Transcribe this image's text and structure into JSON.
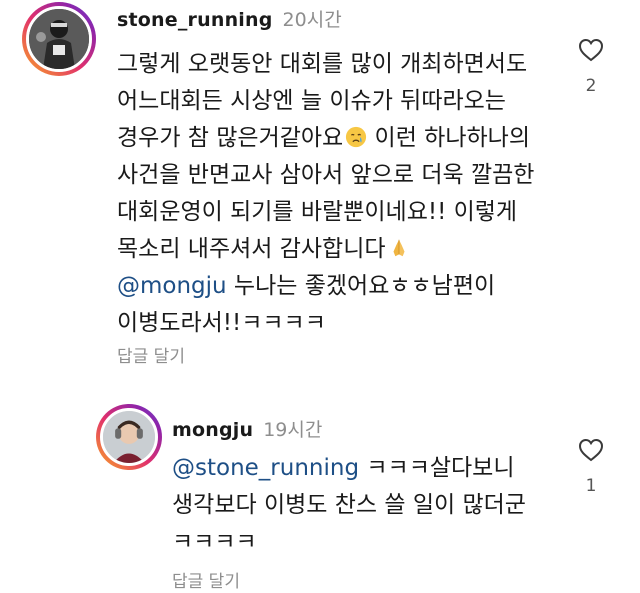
{
  "comments": [
    {
      "username": "stone_running",
      "time": "20시간",
      "lines": [
        "그렇게 오랫동안 대회를 많이 개최하면서도",
        "어느대회든 시상엔 늘 이슈가 뒤따라오는",
        "경우가 참 많은거같아요",
        "사건을 반면교사 삼아서 앞으로 더욱 깔끔한",
        "대회운영이 되기를 바랄뿐이네요!! 이렇게",
        "목소리 내주셔서 감사합니다"
      ],
      "line3_suffix": " 이런 하나하나의",
      "emoji_crying": "crying-face-emoji",
      "emoji_pray": "folded-hands-emoji",
      "mention": "@mongju",
      "mention_suffix": " 누나는 좋겠어요ㅎㅎ남편이",
      "last_line": "이병도라서!!ㅋㅋㅋㅋ",
      "reply_label": "답글 달기",
      "likes": "2"
    },
    {
      "username": "mongju",
      "time": "19시간",
      "mention": "@stone_running",
      "mention_suffix": " ㅋㅋㅋ살다보니",
      "lines": [
        "생각보다 이병도 찬스 쓸 일이 많더군",
        "ㅋㅋㅋㅋ"
      ],
      "reply_label": "답글 달기",
      "likes": "1"
    }
  ],
  "icons": {
    "like": "heart-outline-icon"
  }
}
